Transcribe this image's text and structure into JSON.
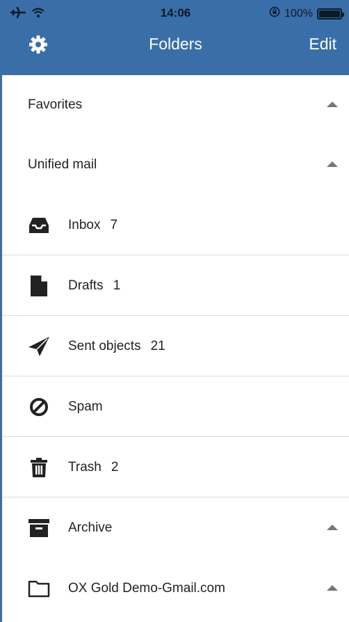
{
  "status_bar": {
    "time": "14:06",
    "battery": "100%",
    "icons": [
      "airplane-icon",
      "wifi-icon",
      "orientation-lock-icon",
      "battery-icon"
    ]
  },
  "nav": {
    "title": "Folders",
    "edit_label": "Edit",
    "settings_icon": "gear-icon"
  },
  "sections": {
    "favorites": "Favorites",
    "unified": "Unified mail"
  },
  "folders": [
    {
      "label": "Inbox",
      "count": "7",
      "icon": "inbox-icon"
    },
    {
      "label": "Drafts",
      "count": "1",
      "icon": "draft-document-icon"
    },
    {
      "label": "Sent objects",
      "count": "21",
      "icon": "paper-plane-icon"
    },
    {
      "label": "Spam",
      "count": "",
      "icon": "spam-block-icon"
    },
    {
      "label": "Trash",
      "count": "2",
      "icon": "trash-icon"
    },
    {
      "label": "Archive",
      "count": "",
      "icon": "archive-box-icon"
    },
    {
      "label": "OX Gold Demo-Gmail.com",
      "count": "",
      "icon": "folder-icon"
    }
  ],
  "colors": {
    "header_bg": "#3a6ea8",
    "icon": "#222222",
    "divider": "#dcdcdc"
  }
}
